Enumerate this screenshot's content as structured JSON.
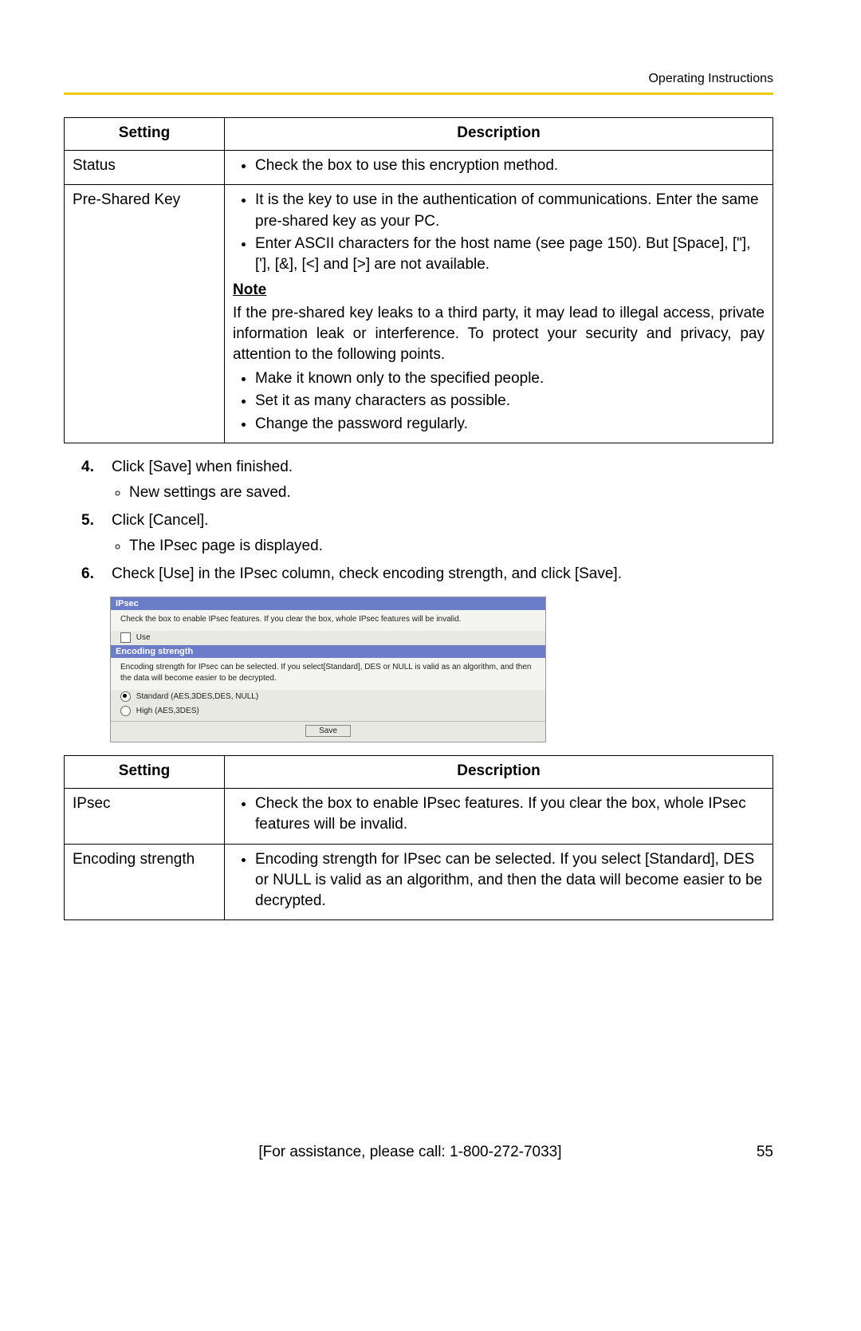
{
  "header": {
    "title": "Operating Instructions"
  },
  "table1": {
    "header": {
      "setting": "Setting",
      "description": "Description"
    },
    "rows": [
      {
        "setting": "Status",
        "bullets": [
          "Check the box to use this encryption method."
        ]
      },
      {
        "setting": "Pre-Shared Key",
        "bullets_top": [
          "It is the key to use in the authentication of communications. Enter the same pre-shared key as your PC.",
          "Enter ASCII characters for the host name (see page 150). But [Space], [\"], ['], [&], [<] and [>] are not available."
        ],
        "note_label": "Note",
        "note_para": "If the pre-shared key leaks to a third party, it may lead to illegal access, private information leak or interference. To protect your security and privacy, pay attention to the following points.",
        "bullets_bottom": [
          "Make it known only to the specified people.",
          "Set it as many characters as possible.",
          "Change the password regularly."
        ]
      }
    ]
  },
  "steps": [
    {
      "num": "4.",
      "text": "Click [Save] when finished.",
      "sub": [
        "New settings are saved."
      ]
    },
    {
      "num": "5.",
      "text": "Click [Cancel].",
      "sub": [
        "The IPsec page is displayed."
      ]
    },
    {
      "num": "6.",
      "text": "Check [Use] in the IPsec column, check encoding strength, and click [Save].",
      "sub": []
    }
  ],
  "screenshot": {
    "ipsec_hdr": "IPsec",
    "ipsec_desc": "Check the box to enable IPsec features. If you clear the box, whole IPsec features will be invalid.",
    "use_label": "Use",
    "enc_hdr": "Encoding strength",
    "enc_desc": "Encoding strength for IPsec can be selected. If you select[Standard], DES or NULL is valid as an algorithm, and then the data will become easier to be decrypted.",
    "opt_standard": "Standard (AES,3DES,DES, NULL)",
    "opt_high": "High (AES,3DES)",
    "save_btn": "Save"
  },
  "table2": {
    "header": {
      "setting": "Setting",
      "description": "Description"
    },
    "rows": [
      {
        "setting": "IPsec",
        "bullets": [
          "Check the box to enable IPsec features. If you clear the box, whole IPsec features will be invalid."
        ]
      },
      {
        "setting": "Encoding strength",
        "bullets": [
          "Encoding strength for IPsec can be selected. If you select [Standard], DES or NULL is valid as an algorithm, and then the data will become easier to be decrypted."
        ]
      }
    ]
  },
  "footer": {
    "assist": "[For assistance, please call: 1-800-272-7033]",
    "page": "55"
  }
}
